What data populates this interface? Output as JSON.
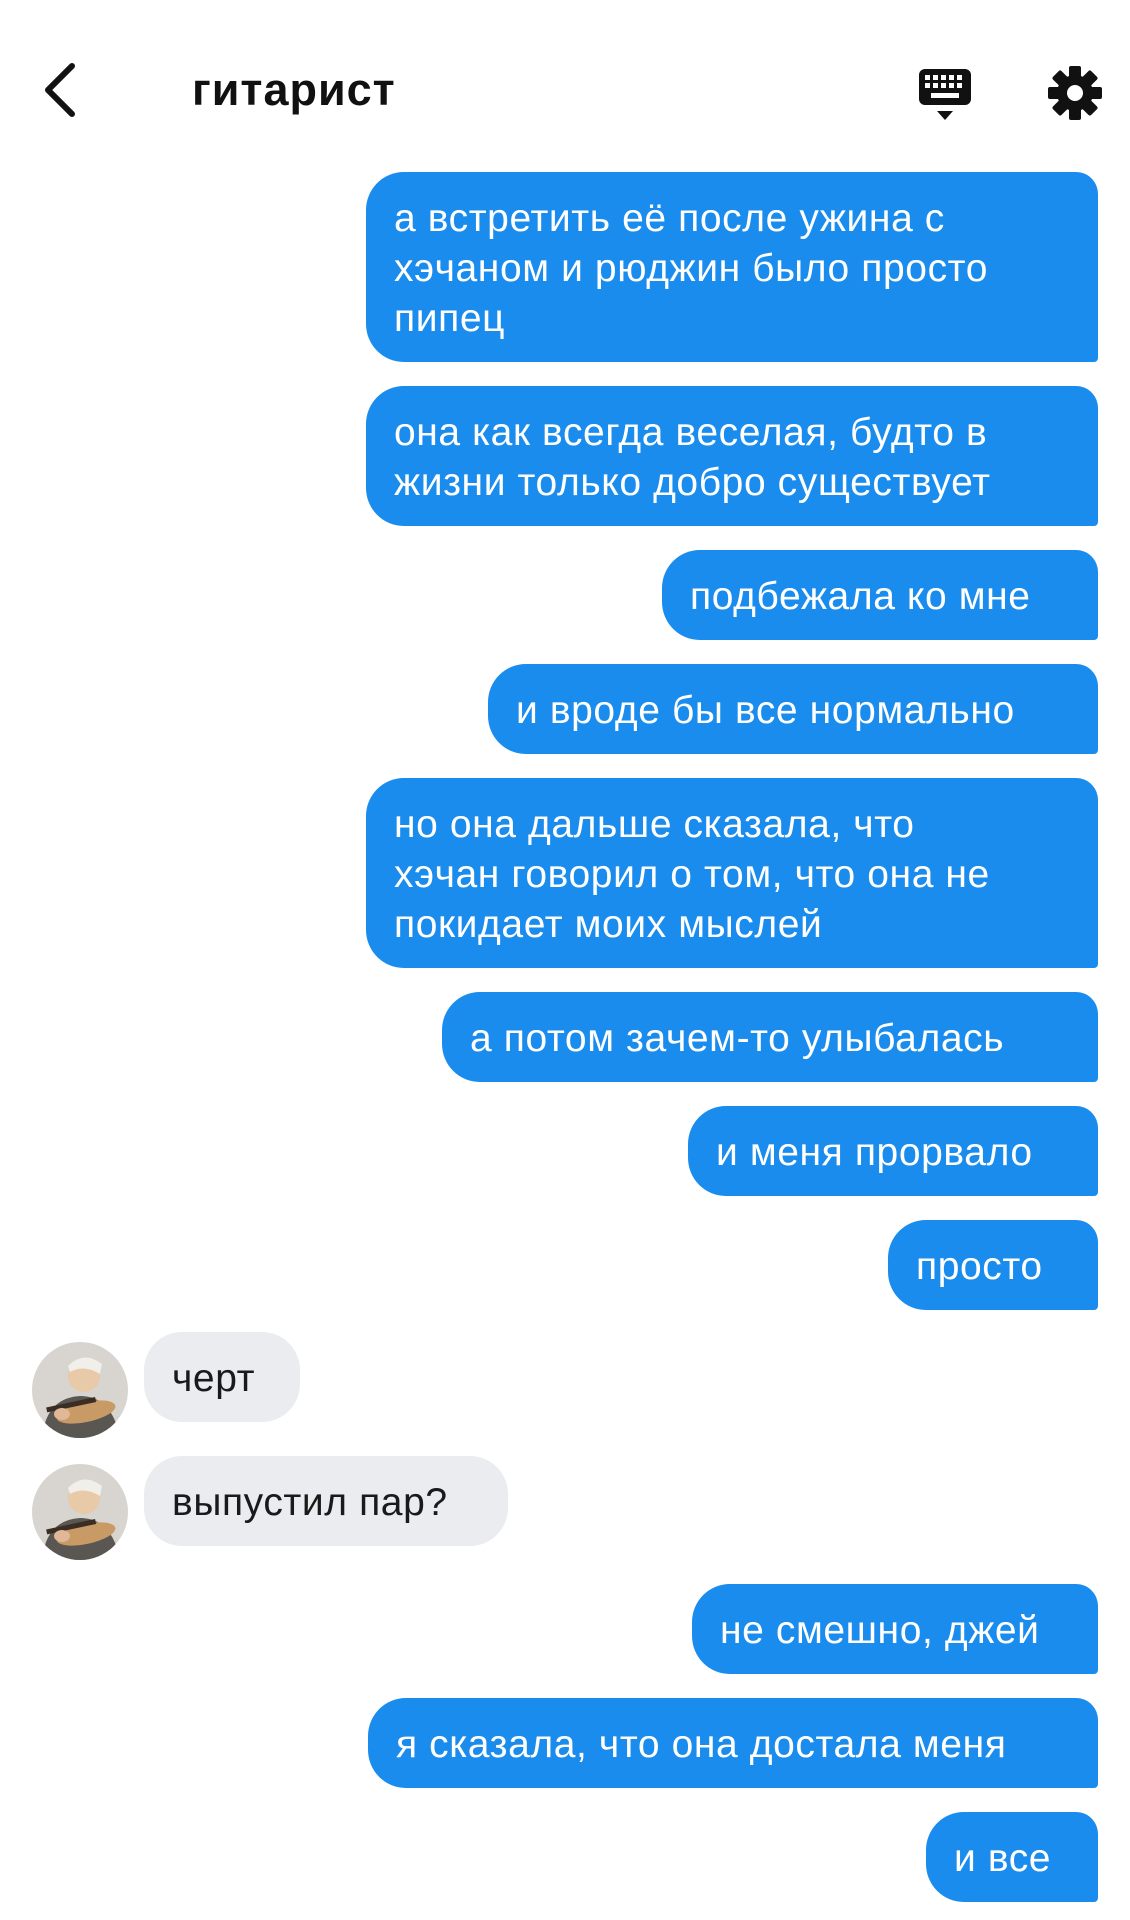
{
  "header": {
    "title": "гитарист",
    "back_icon": "chevron-left-icon",
    "keyboard_icon": "keyboard-icon",
    "settings_icon": "gear-icon"
  },
  "colors": {
    "outgoing_bubble": "#1a8cee",
    "incoming_bubble": "#eaecf0"
  },
  "messages": [
    {
      "from": "me",
      "lines": [
        "а встретить её после ужина с",
        "хэчаном и рюджин было просто",
        "пипец"
      ]
    },
    {
      "from": "me",
      "lines": [
        "она как всегда веселая, будто в",
        "жизни только добро существует"
      ]
    },
    {
      "from": "me",
      "lines": [
        "подбежала ко мне"
      ]
    },
    {
      "from": "me",
      "lines": [
        "и вроде бы все нормально"
      ]
    },
    {
      "from": "me",
      "lines": [
        "но она дальше сказала, что",
        "хэчан говорил о том, что она не",
        "покидает моих мыслей"
      ]
    },
    {
      "from": "me",
      "lines": [
        "а потом зачем-то улыбалась"
      ]
    },
    {
      "from": "me",
      "lines": [
        "и меня прорвало"
      ]
    },
    {
      "from": "me",
      "lines": [
        "просто"
      ]
    },
    {
      "from": "them",
      "lines": [
        "черт"
      ]
    },
    {
      "from": "them",
      "lines": [
        "выпустил пар?"
      ]
    },
    {
      "from": "me",
      "lines": [
        "не смешно, джей"
      ]
    },
    {
      "from": "me",
      "lines": [
        "я сказала, что она достала меня"
      ]
    },
    {
      "from": "me",
      "lines": [
        "и все"
      ]
    }
  ]
}
